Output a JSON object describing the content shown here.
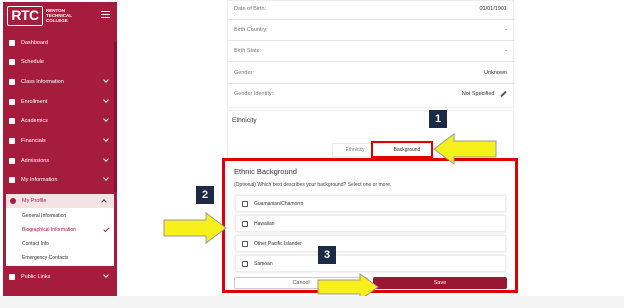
{
  "app": {
    "logo": "RTC",
    "college_name": "RENTON TECHNICAL COLLEGE"
  },
  "sidebar": {
    "items": [
      {
        "label": "Dashboard",
        "icon": "home-icon",
        "has_chevron": false
      },
      {
        "label": "Schedule",
        "icon": "calendar-icon",
        "has_chevron": false
      },
      {
        "label": "Class Information",
        "icon": "book-icon",
        "has_chevron": true
      },
      {
        "label": "Enrollment",
        "icon": "graduation-cap-icon",
        "has_chevron": true
      },
      {
        "label": "Academics",
        "icon": "academics-icon",
        "has_chevron": true
      },
      {
        "label": "Financials",
        "icon": "wallet-icon",
        "has_chevron": true
      },
      {
        "label": "Admissions",
        "icon": "admissions-icon",
        "has_chevron": true
      },
      {
        "label": "My Information",
        "icon": "person-icon",
        "has_chevron": true
      }
    ],
    "profile": {
      "label": "My Profile",
      "sub_items": [
        {
          "label": "General Information",
          "active": false
        },
        {
          "label": "Biographical Information",
          "active": true
        },
        {
          "label": "Contact Info",
          "active": false
        },
        {
          "label": "Emergency Contacts",
          "active": false
        }
      ]
    },
    "public_links": "Public Links"
  },
  "biographical": {
    "fields": [
      {
        "key": "Date of Birth:",
        "value": "01/01/1901"
      },
      {
        "key": "Birth Country:",
        "value": "-"
      },
      {
        "key": "Birth State:",
        "value": "-"
      },
      {
        "key": "Gender:",
        "value": "Unknown"
      },
      {
        "key": "Gender Identity:",
        "value": "Not Specified"
      }
    ]
  },
  "ethnicity": {
    "title": "Ethnicity",
    "tabs": [
      "Ethnicity",
      "Background"
    ]
  },
  "ethnic_background": {
    "title": "Ethnic Background",
    "instructions": "(Optional) Which best describes your background? Select one or more.",
    "options": [
      "Guamanian/Chamorro",
      "Hawaiian",
      "Other Pacific Islander",
      "Samoan"
    ],
    "cancel_label": "Cancel",
    "save_label": "Save"
  },
  "callouts": [
    "1",
    "2",
    "3"
  ],
  "colors": {
    "brand": "#a61c3c",
    "save_button": "#9b1632",
    "highlight": "#e00000",
    "arrow": "#f7f01a",
    "callout": "#1c2a48"
  }
}
